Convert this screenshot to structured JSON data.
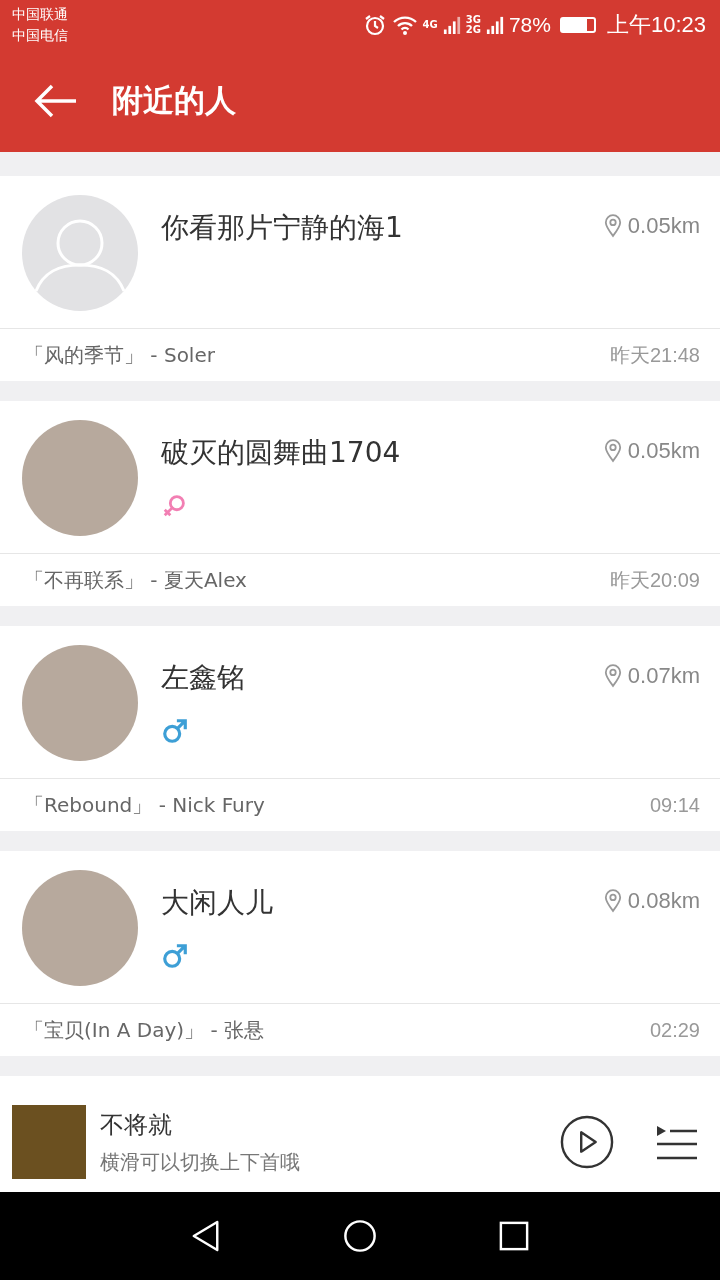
{
  "status_bar": {
    "carriers": [
      "中国联通",
      "中国电信"
    ],
    "network_4g": "4G",
    "network_3g": "3G",
    "network_2g": "2G",
    "battery_text": "78%",
    "battery": {
      "level": 0.78
    },
    "time": "上午10:23"
  },
  "header": {
    "title": "附近的人"
  },
  "people": [
    {
      "name": "你看那片宁静的海1",
      "kind": "default",
      "male": false,
      "female": false,
      "distance": "0.05km",
      "song": "「风的季节」 - Soler",
      "time": "昨天21:48"
    },
    {
      "name": "破灭的圆舞曲1704",
      "kind": "photo",
      "male": false,
      "female": true,
      "distance": "0.05km",
      "song": "「不再联系」 - 夏天Alex",
      "time": "昨天20:09"
    },
    {
      "name": "左鑫铭",
      "kind": "photo",
      "male": true,
      "female": false,
      "distance": "0.07km",
      "song": "「Rebound」 - Nick Fury",
      "time": "09:14"
    },
    {
      "name": "大闲人儿",
      "kind": "photo",
      "male": true,
      "female": false,
      "distance": "0.08km",
      "song": "「宝贝(In A Day)」 - 张悬",
      "time": "02:29"
    }
  ],
  "player": {
    "title": "不将就",
    "subtitle": "横滑可以切换上下首哦"
  }
}
